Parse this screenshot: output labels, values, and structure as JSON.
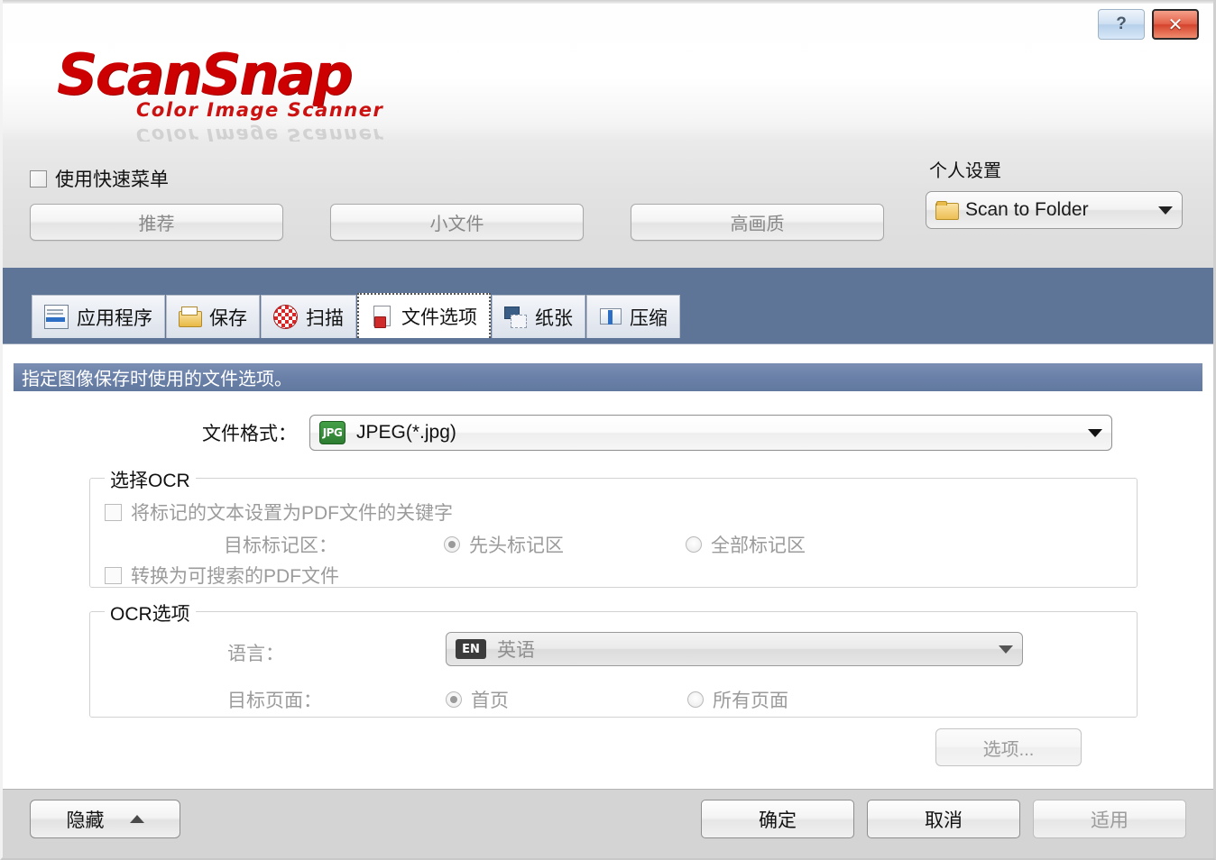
{
  "window": {
    "help_button": "?",
    "close_button": "✕"
  },
  "logo": {
    "main": "ScanSnap",
    "sub": "Color Image Scanner"
  },
  "quick_menu": {
    "label": "使用快速菜单",
    "checked": false
  },
  "profile": {
    "label": "个人设置",
    "selected": "Scan to Folder"
  },
  "presets": [
    {
      "label": "推荐"
    },
    {
      "label": "小文件"
    },
    {
      "label": "高画质"
    }
  ],
  "tabs": [
    {
      "label": "应用程序",
      "icon": "application-icon",
      "active": false
    },
    {
      "label": "保存",
      "icon": "folder-save-icon",
      "active": false
    },
    {
      "label": "扫描",
      "icon": "scanning-ball-icon",
      "active": false
    },
    {
      "label": "文件选项",
      "icon": "file-option-icon",
      "active": true
    },
    {
      "label": "纸张",
      "icon": "paper-icon",
      "active": false
    },
    {
      "label": "压缩",
      "icon": "compression-icon",
      "active": false
    }
  ],
  "panel": {
    "hint": "指定图像保存时使用的文件选项。",
    "file_format": {
      "label": "文件格式：",
      "value": "JPEG(*.jpg)",
      "icon_text": "JPG"
    },
    "ocr_select": {
      "title": "选择OCR",
      "checkbox_keyword": "将标记的文本设置为PDF文件的关键字",
      "checkbox_keyword_checked": false,
      "marked_area_label": "目标标记区：",
      "radio_first": "先头标记区",
      "radio_all": "全部标记区",
      "radio_selected": "先头标记区",
      "checkbox_searchable": "转换为可搜索的PDF文件",
      "checkbox_searchable_checked": false
    },
    "ocr_options": {
      "title": "OCR选项",
      "language_label": "语言：",
      "language_value": "英语",
      "language_icon_text": "EN",
      "target_pages_label": "目标页面：",
      "radio_first_page": "首页",
      "radio_all_pages": "所有页面",
      "radio_selected": "首页"
    },
    "options_button": "选项..."
  },
  "footer": {
    "hide_button": "隐藏",
    "ok_button": "确定",
    "cancel_button": "取消",
    "apply_button": "适用"
  },
  "colors": {
    "brand_red": "#cc0000",
    "tab_band_blue": "#5f7598",
    "hint_bar_blue": "#6a80a8",
    "jpg_green": "#2e7d32"
  }
}
